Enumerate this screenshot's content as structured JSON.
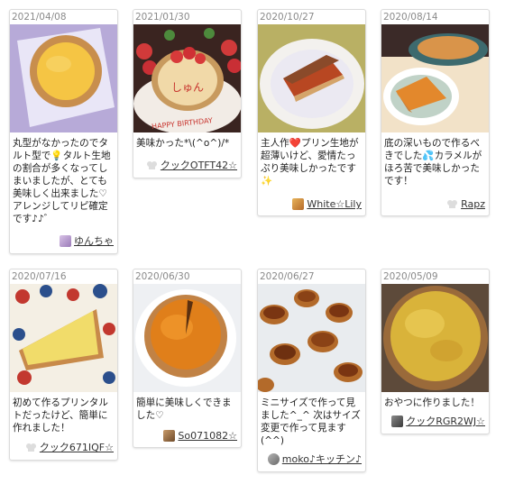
{
  "cards": [
    {
      "date": "2021/04/08",
      "text": "丸型がなかったのでタルト型で💡タルト生地の割合が多くなってしまいましたが、とても美味しく出来ました♡ アレンジしてリピ確定です♪♪゛",
      "author": "ゆんちゃ",
      "avatar": "avatar-photo"
    },
    {
      "date": "2021/01/30",
      "text": "美味かった*\\(^o^)/*",
      "author": "クックOTFT42☆",
      "avatar": "chef-hat-icon"
    },
    {
      "date": "2020/10/27",
      "text": "主人作❤️プリン生地が超薄いけど、愛情たっぷり美味しかったです✨",
      "author": "White☆Lily",
      "avatar": "avatar-photo"
    },
    {
      "date": "2020/08/14",
      "text": "底の深いもので作るべきでした💦カラメルがほろ苦で美味しかったです！",
      "author": "Rapz",
      "avatar": "chef-hat-icon"
    },
    {
      "date": "2020/07/16",
      "text": "初めて作るプリンタルトだったけど、簡単に作れました！",
      "author": "クック671IQF☆",
      "avatar": "chef-hat-icon"
    },
    {
      "date": "2020/06/30",
      "text": "簡単に美味しくできました♡",
      "author": "So071082☆",
      "avatar": "avatar-photo"
    },
    {
      "date": "2020/06/27",
      "text": "ミニサイズで作って見ました^_^ 次はサイズ変更で作って見ます(^^)",
      "author": "moko♪キッチン♪",
      "avatar": "avatar-photo"
    },
    {
      "date": "2020/05/09",
      "text": "おやつに作りました！",
      "author": "クックRGR2WJ☆",
      "avatar": "avatar-photo"
    }
  ],
  "cake_text": "しゅん",
  "plate_text": "HAPPY BIRTHDAY"
}
